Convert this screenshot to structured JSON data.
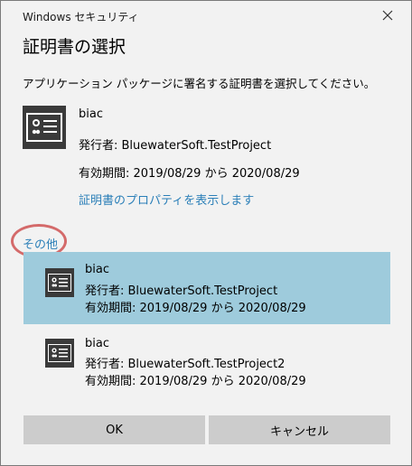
{
  "window": {
    "title": "Windows セキュリティ"
  },
  "dialog": {
    "heading": "証明書の選択",
    "instruction": "アプリケーション パッケージに署名する証明書を選択してください。"
  },
  "selected_cert": {
    "name": "biac",
    "issuer": "発行者: BluewaterSoft.TestProject",
    "validity": "有効期間: 2019/08/29 から 2020/08/29",
    "properties_link": "証明書のプロパティを表示します"
  },
  "others_label": "その他",
  "cert_list": [
    {
      "name": "biac",
      "issuer": "発行者: BluewaterSoft.TestProject",
      "validity": "有効期間: 2019/08/29 から 2020/08/29",
      "selected": true
    },
    {
      "name": "biac",
      "issuer": "発行者: BluewaterSoft.TestProject2",
      "validity": "有効期間: 2019/08/29 から 2020/08/29",
      "selected": false
    }
  ],
  "buttons": {
    "ok": "OK",
    "cancel": "キャンセル"
  },
  "colors": {
    "link": "#2b7fb8",
    "selected_bg": "#9ecbdc",
    "button_bg": "#cccccc",
    "highlight_ring": "#d46a6a"
  }
}
